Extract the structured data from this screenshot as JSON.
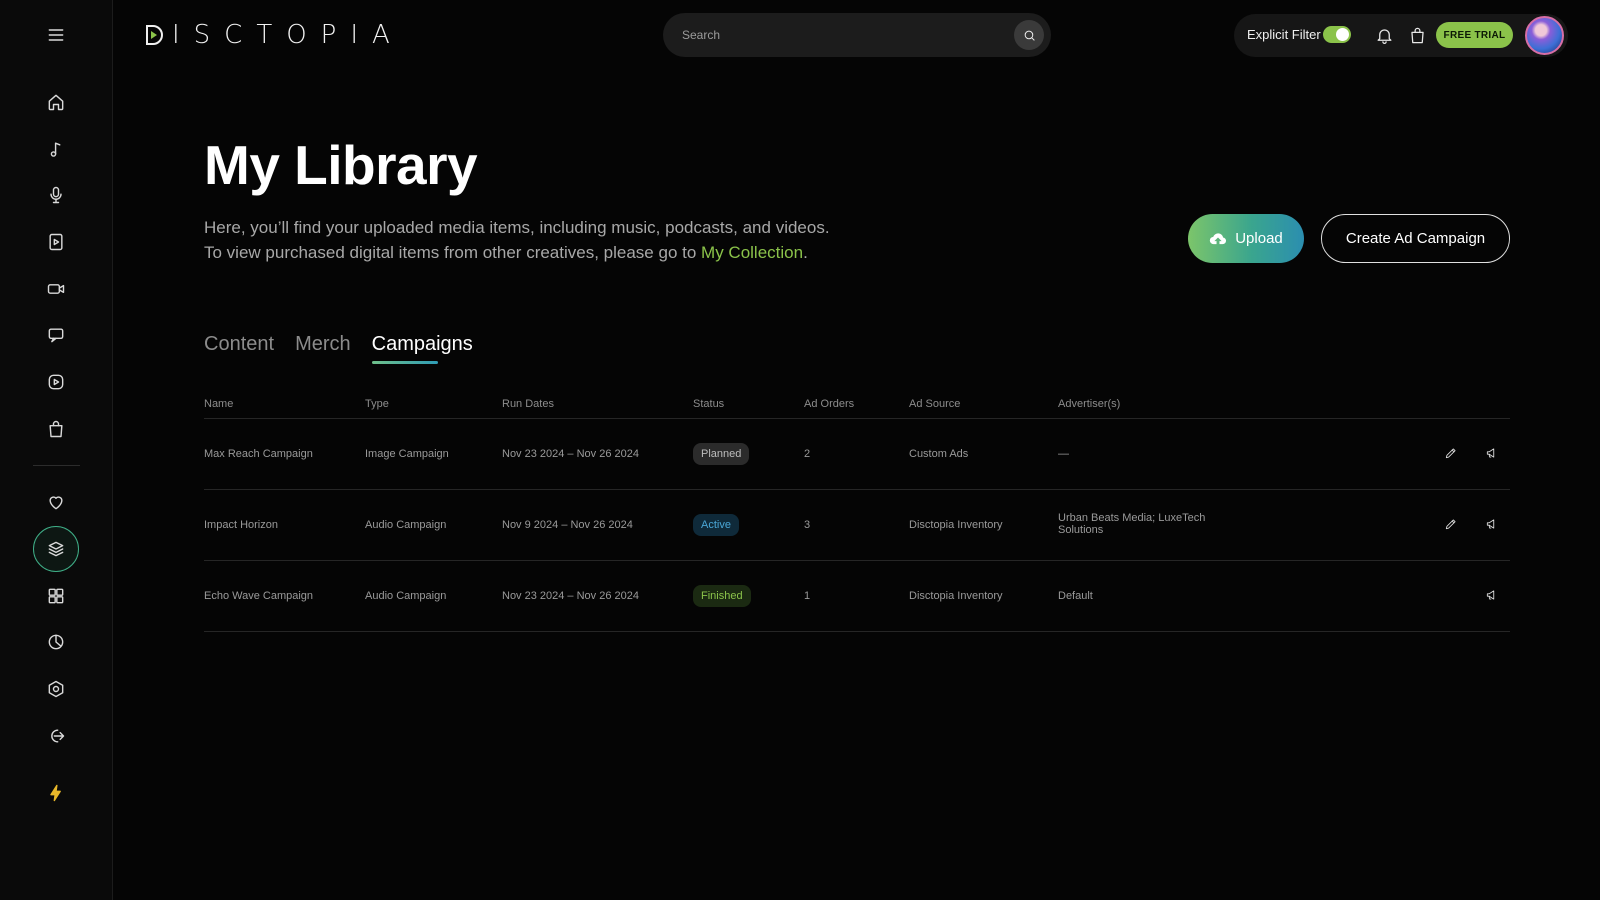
{
  "app": {
    "logo_text": "ISCTOPIA"
  },
  "sidebar": {
    "items": [
      {
        "icon": "menu-icon"
      },
      {
        "icon": "home-icon"
      },
      {
        "icon": "music-note-icon"
      },
      {
        "icon": "microphone-icon"
      },
      {
        "icon": "video-file-icon"
      },
      {
        "icon": "video-camera-icon"
      },
      {
        "icon": "chat-icon"
      },
      {
        "icon": "play-circle-icon"
      },
      {
        "icon": "shopping-bag-icon"
      },
      {
        "icon": "heart-icon"
      },
      {
        "icon": "layers-icon",
        "active": true
      },
      {
        "icon": "grid-icon"
      },
      {
        "icon": "pie-chart-icon"
      },
      {
        "icon": "settings-icon"
      },
      {
        "icon": "logout-icon"
      },
      {
        "icon": "lightning-icon"
      }
    ]
  },
  "header": {
    "search_placeholder": "Search",
    "explicit_filter_label": "Explicit Filter",
    "explicit_filter_on": true,
    "free_trial_label": "FREE TRIAL"
  },
  "hero": {
    "title": "My Library",
    "subtitle_line1": "Here, you’ll find your uploaded media items, including music, podcasts, and videos.",
    "subtitle_line2_prefix": "To view purchased digital items from other creatives, please go to ",
    "subtitle_link": "My Collection",
    "subtitle_line2_suffix": ".",
    "upload_label": "Upload",
    "create_campaign_label": "Create Ad Campaign"
  },
  "tabs": [
    {
      "label": "Content",
      "active": false
    },
    {
      "label": "Merch",
      "active": false
    },
    {
      "label": "Campaigns",
      "active": true
    }
  ],
  "table": {
    "headers": [
      "Name",
      "Type",
      "Run Dates",
      "Status",
      "Ad Orders",
      "Ad Source",
      "Advertiser(s)"
    ],
    "rows": [
      {
        "name": "Max Reach Campaign",
        "type": "Image Campaign",
        "dates": "Nov 23 2024 – Nov 26 2024",
        "status": "Planned",
        "orders": "2",
        "source": "Custom Ads",
        "advertisers": "—",
        "editable": true
      },
      {
        "name": "Impact Horizon",
        "type": "Audio Campaign",
        "dates": "Nov 9 2024 – Nov 26 2024",
        "status": "Active",
        "orders": "3",
        "source": "Disctopia Inventory",
        "advertisers": "Urban Beats Media; LuxeTech Solutions",
        "editable": true
      },
      {
        "name": "Echo Wave Campaign",
        "type": "Audio Campaign",
        "dates": "Nov 23 2024 – Nov 26 2024",
        "status": "Finished",
        "orders": "1",
        "source": "Disctopia Inventory",
        "advertisers": "Default",
        "editable": false
      }
    ]
  },
  "colors": {
    "accent_green": "#8bc34a",
    "active_blue": "#4aa6d6",
    "background": "#050505"
  }
}
